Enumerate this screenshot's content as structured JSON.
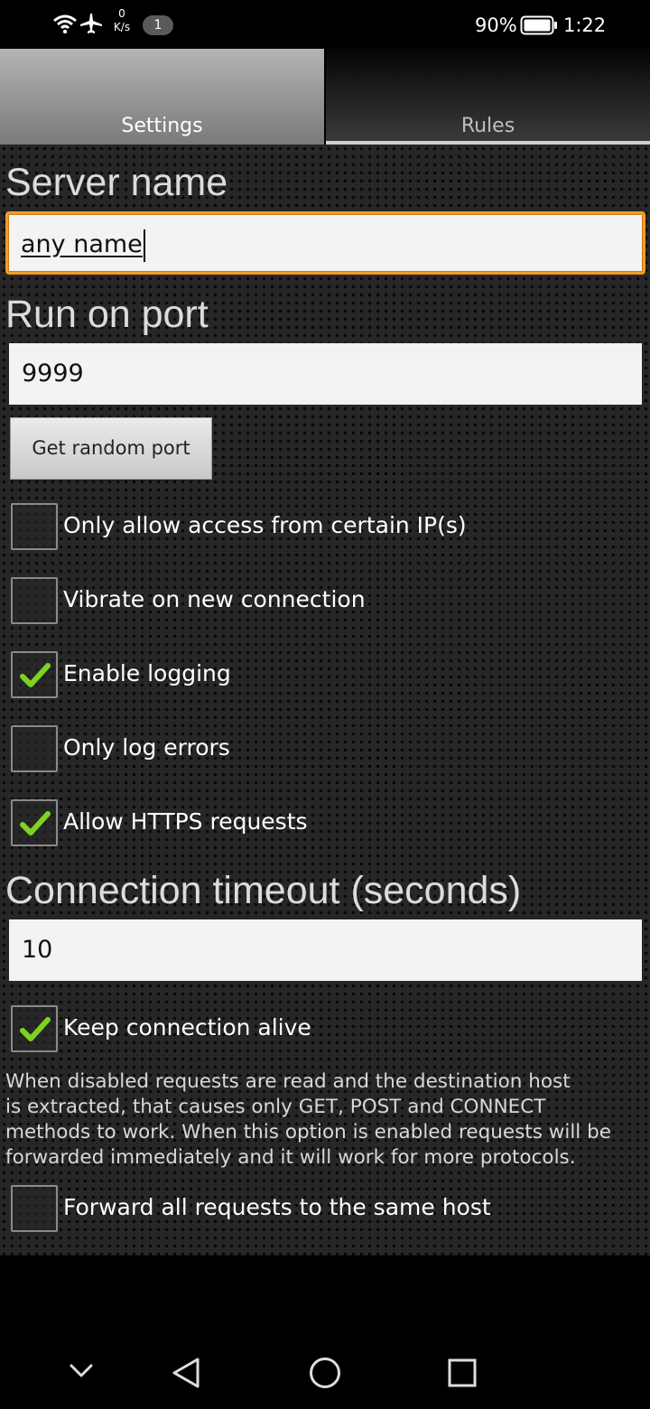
{
  "status_bar": {
    "net_speed_value": "0",
    "net_speed_unit": "K/s",
    "notification_count": "1",
    "battery_percent": "90%",
    "time": "1:22"
  },
  "tabs": [
    {
      "label": "Settings",
      "selected": true
    },
    {
      "label": "Rules",
      "selected": false
    }
  ],
  "server_name": {
    "title": "Server name",
    "value": "any name"
  },
  "port": {
    "title": "Run on port",
    "value": "9999",
    "random_button": "Get random port"
  },
  "options": [
    {
      "label": "Only allow access from certain IP(s)",
      "checked": false
    },
    {
      "label": "Vibrate on new connection",
      "checked": false
    },
    {
      "label": "Enable logging",
      "checked": true
    },
    {
      "label": "Only log errors",
      "checked": false
    },
    {
      "label": "Allow HTTPS requests",
      "checked": true
    }
  ],
  "timeout": {
    "title": "Connection timeout (seconds)",
    "value": "10"
  },
  "keep_alive": {
    "label": "Keep connection alive",
    "checked": true,
    "description": "When disabled requests are read and the destination host\nis extracted, that causes only GET, POST and CONNECT\nmethods to work. When this option is enabled requests will be\nforwarded immediately and it will work for more protocols."
  },
  "forward_all": {
    "label": "Forward all requests to the same host",
    "checked": false
  },
  "colors": {
    "accent_focus": "#f39c27",
    "check_green": "#7ed321"
  },
  "nav_icons": [
    "chevron-down-icon",
    "back-icon",
    "home-icon",
    "recents-icon"
  ]
}
